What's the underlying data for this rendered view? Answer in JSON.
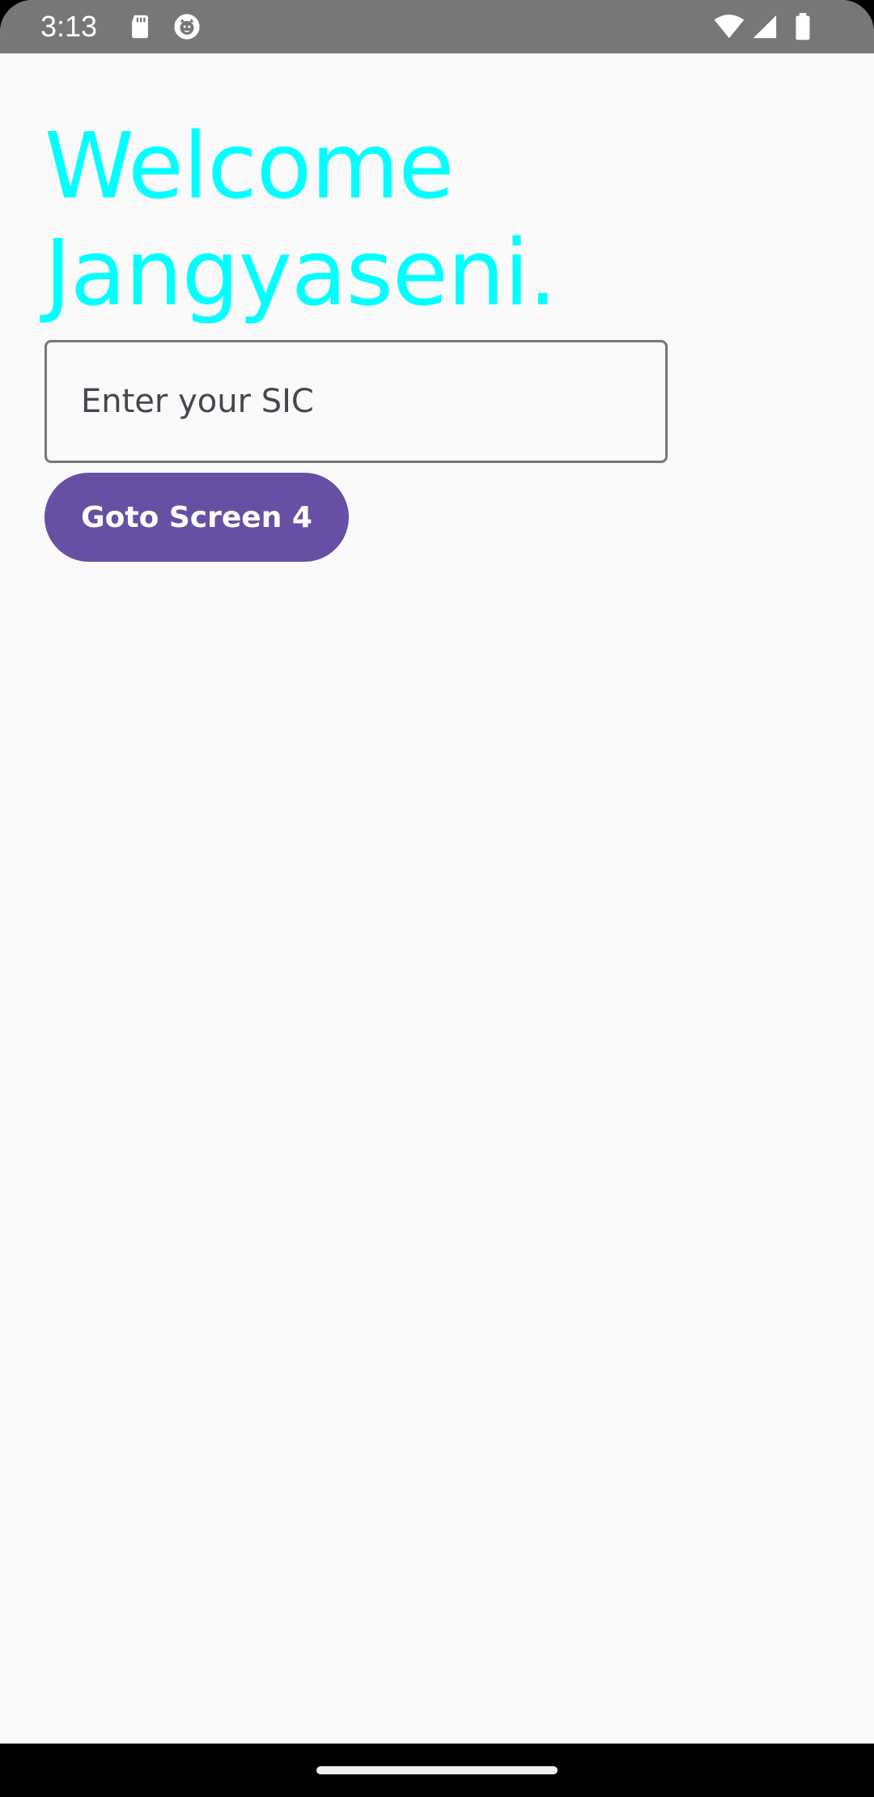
{
  "status_bar": {
    "time": "3:13",
    "icons": [
      "sd-card-icon",
      "cat-icon",
      "wifi-icon",
      "signal-icon",
      "battery-icon"
    ],
    "background": "#777777"
  },
  "main": {
    "title": "Welcome Jangyaseni.",
    "title_color": "#00ffff",
    "sic_input": {
      "placeholder": "Enter your SIC",
      "value": ""
    },
    "goto_button": {
      "label": "Goto Screen 4",
      "color": "#6750a4"
    }
  },
  "nav_bar": {
    "handle": "home-handle"
  }
}
